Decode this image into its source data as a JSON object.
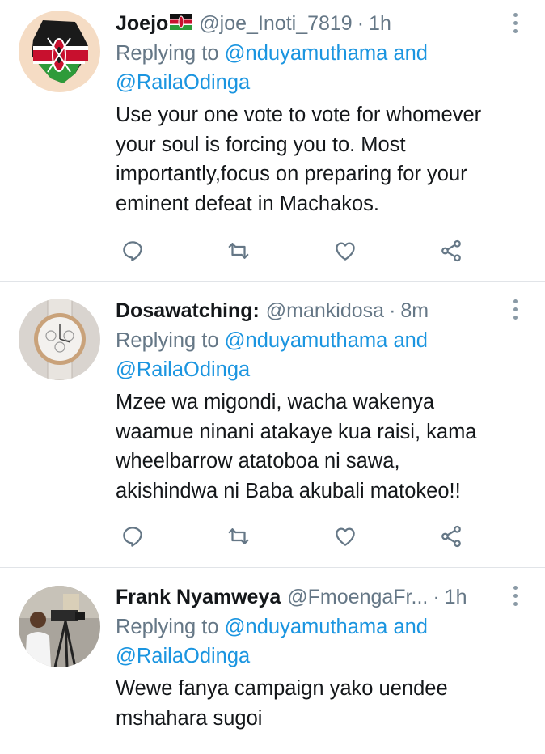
{
  "tweets": [
    {
      "name": "Joejo",
      "handle": "@joe_Inoti_7819",
      "dot": "·",
      "time": "1h",
      "reply_prefix": "Replying to",
      "reply_user1": "@nduyamuthama",
      "reply_and": "and",
      "reply_user2": "@RailaOdinga",
      "text": "Use your one vote to vote for whomever your soul is forcing you to. Most importantly,focus on preparing for your eminent defeat in Machakos.",
      "avatar_icon": "kenya-map-flag-avatar"
    },
    {
      "name": "Dosawatching:",
      "handle": "@mankidosa",
      "dot": "·",
      "time": "8m",
      "reply_prefix": "Replying to",
      "reply_user1": "@nduyamuthama",
      "reply_and": "and",
      "reply_user2": "@RailaOdinga",
      "text": "Mzee wa migondi, wacha wakenya waamue ninani atakaye kua raisi, kama wheelbarrow atatoboa ni sawa, akishindwa ni Baba akubali matokeo!!",
      "avatar_icon": "wristwatch-avatar"
    },
    {
      "name": "Frank Nyamweya",
      "handle": "@FmoengaFr...",
      "dot": "·",
      "time": "1h",
      "reply_prefix": "Replying to",
      "reply_user1": "@nduyamuthama",
      "reply_and": "and",
      "reply_user2": "@RailaOdinga",
      "text": "Wewe fanya campaign yako uendee mshahara sugoi",
      "avatar_icon": "camera-operator-avatar"
    }
  ],
  "icons": {
    "reply": "reply-icon",
    "retweet": "retweet-icon",
    "like": "like-icon",
    "share": "share-icon",
    "menu": "more-options-icon",
    "flag": "kenya-flag-icon"
  },
  "colors": {
    "link": "#1b95e0",
    "muted": "#657786",
    "text": "#14171a",
    "divider": "#e1e4e8"
  }
}
